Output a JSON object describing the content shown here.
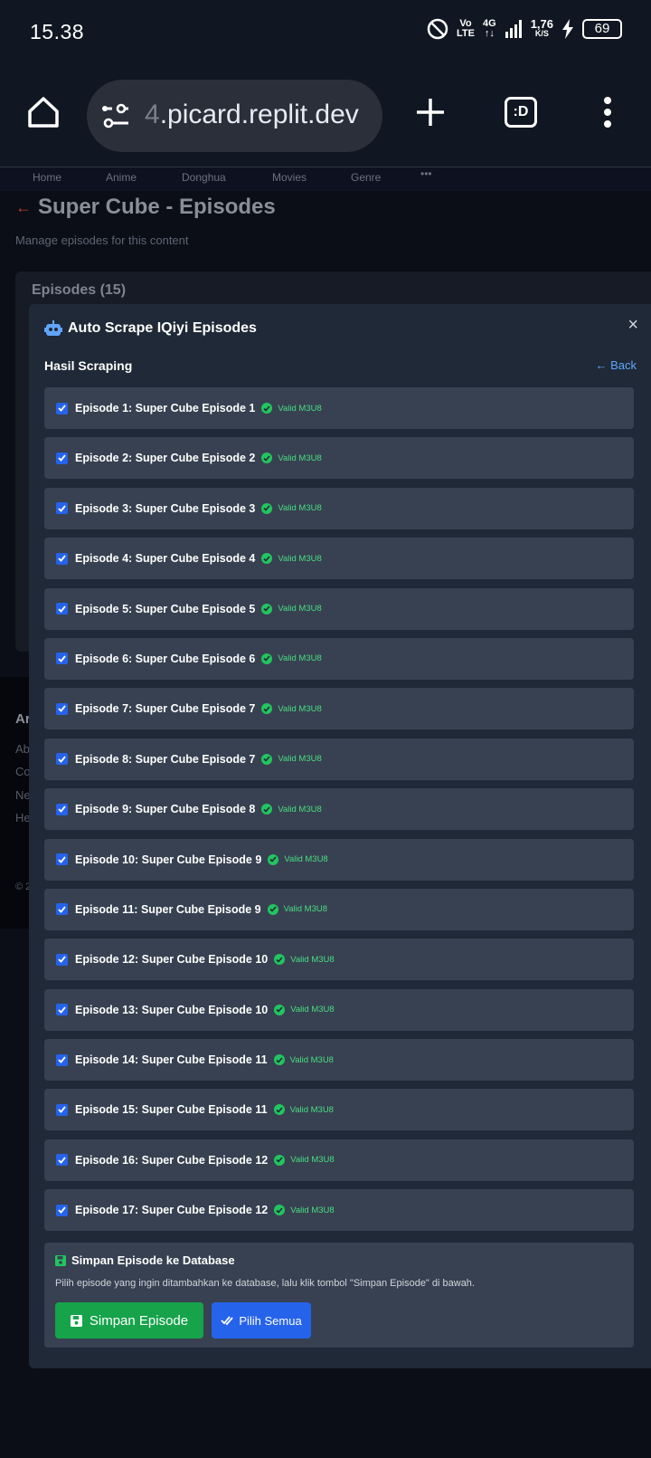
{
  "status_bar": {
    "time": "15.38",
    "volte_top": "Vo",
    "volte_bottom": "LTE",
    "network_top": "4G",
    "network_bottom": "↑↓",
    "speed_top": "1,76",
    "speed_bottom": "K/S",
    "battery": "69"
  },
  "browser": {
    "url_prefix": "4",
    "url_main": ".picard.replit.dev",
    "tab_icon_label": ":D"
  },
  "site_nav": {
    "items": [
      "Home",
      "Anime",
      "Donghua",
      "Movies",
      "Genre",
      "•••"
    ]
  },
  "page": {
    "title": "Super Cube - Episodes",
    "subtitle": "Manage episodes for this content",
    "episodes_header": "Episodes (15)",
    "footer_fragments": [
      "Ar",
      "Ab",
      "Co",
      "Ne",
      "He",
      "© 2"
    ]
  },
  "modal": {
    "title": "Auto Scrape IQiyi Episodes",
    "close": "×",
    "section_title": "Hasil Scraping",
    "back_label": "Back",
    "valid_label": "Valid M3U8",
    "episodes": [
      "Episode 1: Super Cube Episode 1",
      "Episode 2: Super Cube Episode 2",
      "Episode 3: Super Cube Episode 3",
      "Episode 4: Super Cube Episode 4",
      "Episode 5: Super Cube Episode 5",
      "Episode 6: Super Cube Episode 6",
      "Episode 7: Super Cube Episode 7",
      "Episode 8: Super Cube Episode 7",
      "Episode 9: Super Cube Episode 8",
      "Episode 10: Super Cube Episode 9",
      "Episode 11: Super Cube Episode 9",
      "Episode 12: Super Cube Episode 10",
      "Episode 13: Super Cube Episode 10",
      "Episode 14: Super Cube Episode 11",
      "Episode 15: Super Cube Episode 11",
      "Episode 16: Super Cube Episode 12",
      "Episode 17: Super Cube Episode 12"
    ],
    "save_box": {
      "title": "Simpan Episode ke Database",
      "description": "Pilih episode yang ingin ditambahkan ke database, lalu klik tombol \"Simpan Episode\" di bawah.",
      "save_button": "Simpan Episode",
      "select_all_button": "Pilih Semua"
    }
  },
  "colors": {
    "accent_blue": "#2563eb",
    "success_green": "#16a34a",
    "valid_text": "#4ade80",
    "modal_bg": "#1f2937",
    "row_bg": "#374151"
  }
}
